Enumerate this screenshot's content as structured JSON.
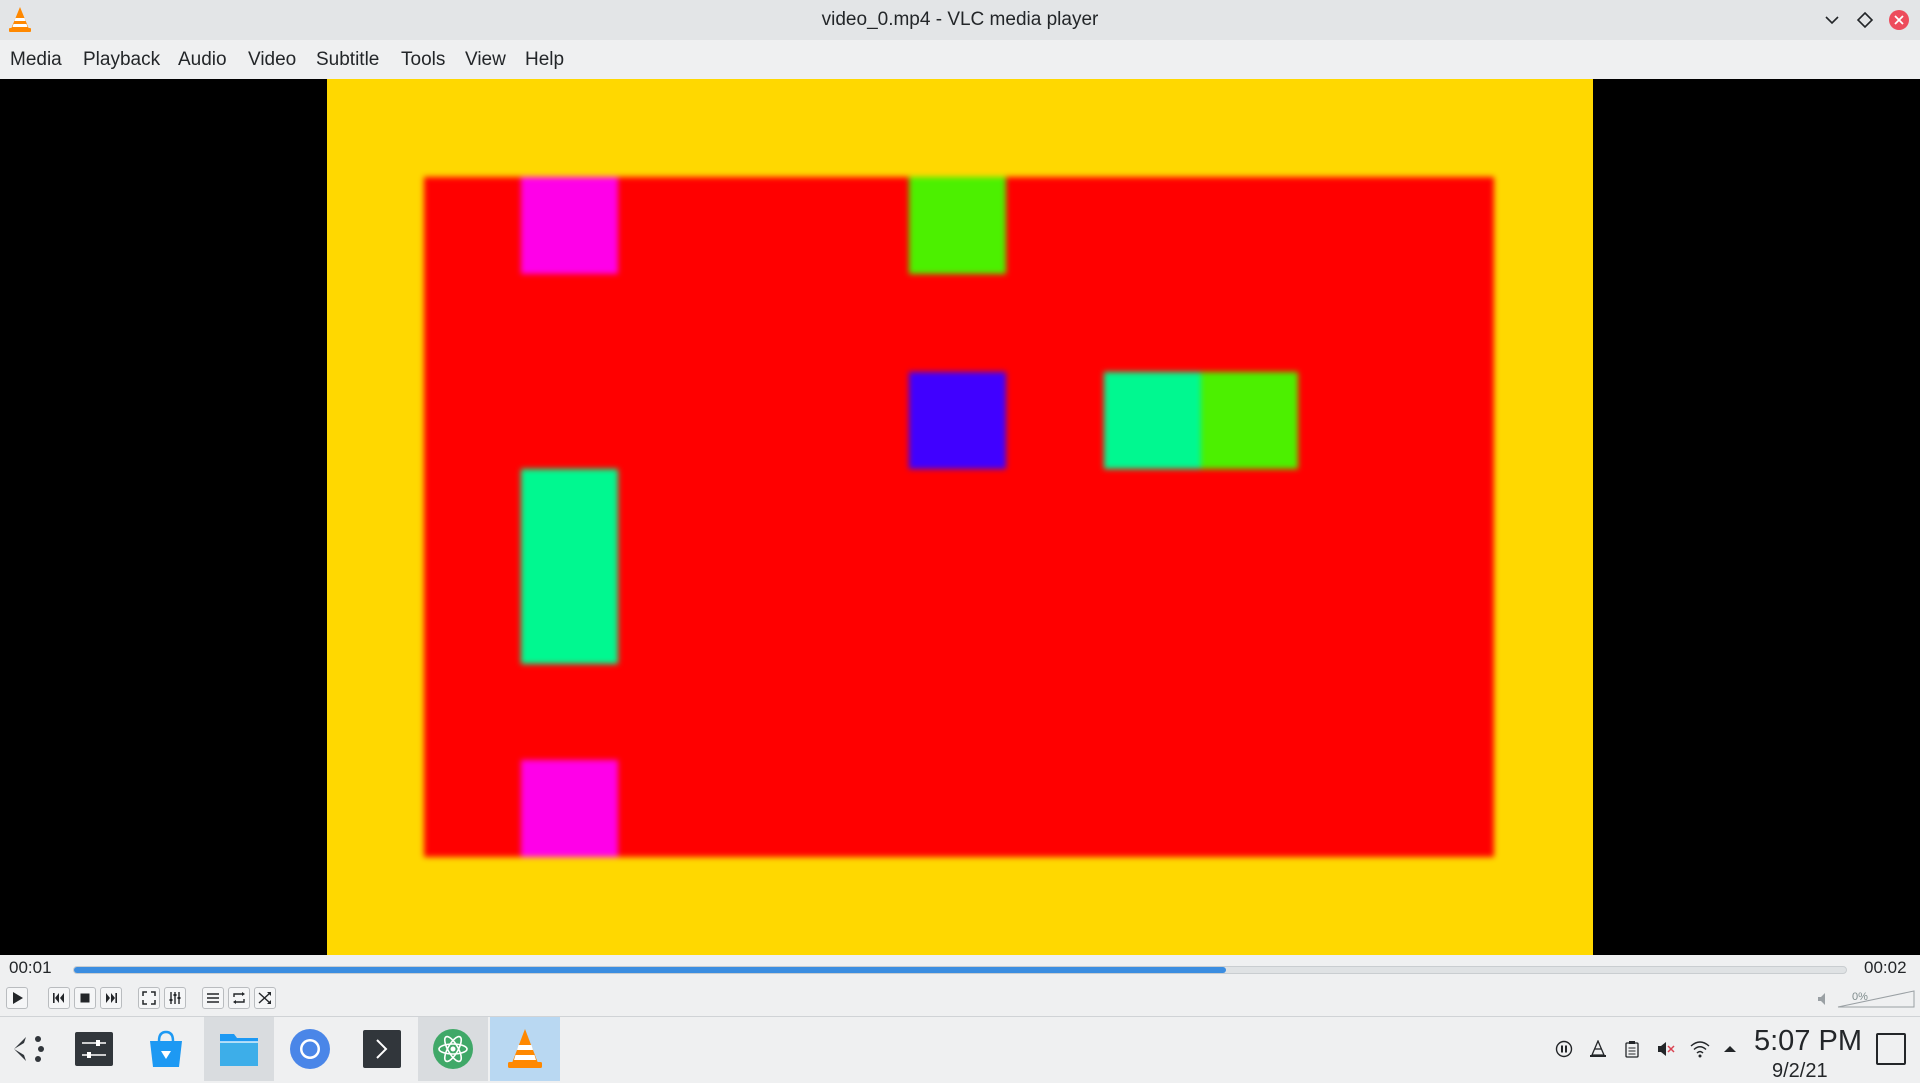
{
  "window": {
    "title": "video_0.mp4 - VLC media player"
  },
  "menu": {
    "items": [
      "Media",
      "Playback",
      "Audio",
      "Video",
      "Subtitle",
      "Tools",
      "View",
      "Help"
    ]
  },
  "video": {
    "colors": {
      "border": "#ffd800",
      "background": "#ff0000",
      "magenta": "#ff00e8",
      "green": "#4cf000",
      "blue": "#4000ff",
      "teal": "#00f890"
    }
  },
  "player": {
    "elapsed": "00:01",
    "total": "00:02",
    "progress_fraction": 0.65,
    "volume_label": "0%",
    "volume_fraction": 0
  },
  "taskbar": {
    "apps": [
      {
        "icon": "app-launcher-icon"
      },
      {
        "icon": "system-settings-icon"
      },
      {
        "icon": "discover-store-icon"
      },
      {
        "icon": "file-manager-icon"
      },
      {
        "icon": "chromium-browser-icon"
      },
      {
        "icon": "terminal-icon"
      },
      {
        "icon": "atom-editor-icon"
      },
      {
        "icon": "vlc-icon"
      }
    ],
    "clock_time": "5:07 PM",
    "clock_date": "9/2/21"
  }
}
